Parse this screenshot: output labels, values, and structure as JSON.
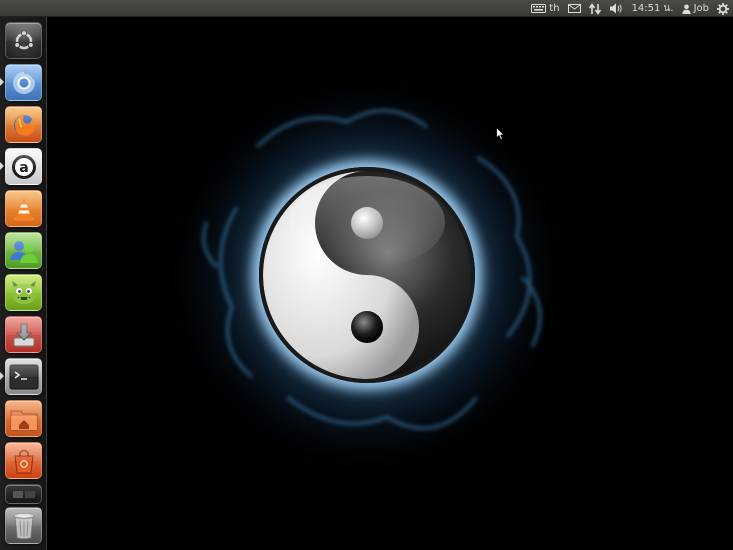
{
  "panel": {
    "keyboard_layout": "th",
    "clock": "14:51 น.",
    "user_name": "Job"
  },
  "launcher": {
    "items": [
      {
        "name": "dash-home",
        "icon": "ubuntu-logo-icon",
        "color": "#2b2b2b"
      },
      {
        "name": "chromium-browser",
        "icon": "chromium-icon",
        "color": "#4a7fc0"
      },
      {
        "name": "firefox",
        "icon": "firefox-icon",
        "color": "#d9652a"
      },
      {
        "name": "amazon",
        "icon": "amazon-icon",
        "color": "#e8e8e8"
      },
      {
        "name": "vlc",
        "icon": "vlc-cone-icon",
        "color": "#e27a1d"
      },
      {
        "name": "empathy",
        "icon": "people-chat-icon",
        "color": "#67b53a"
      },
      {
        "name": "monster-app",
        "icon": "green-monster-icon",
        "color": "#7fb81e"
      },
      {
        "name": "installer",
        "icon": "install-arrow-icon",
        "color": "#c9413a"
      },
      {
        "name": "terminal",
        "icon": "terminal-icon",
        "color": "#2a2a2a"
      },
      {
        "name": "home-folder",
        "icon": "home-folder-icon",
        "color": "#d96a2a"
      },
      {
        "name": "ubuntu-software-center",
        "icon": "shopping-bag-icon",
        "color": "#e05a2a"
      },
      {
        "name": "workspace-switcher",
        "icon": "workspace-icon",
        "color": "#1a1a1a"
      },
      {
        "name": "trash",
        "icon": "trash-icon",
        "color": "#6a6a6a"
      }
    ]
  },
  "wallpaper": {
    "subject": "yin-yang-icon",
    "glow_color": "#5fa8e0"
  }
}
